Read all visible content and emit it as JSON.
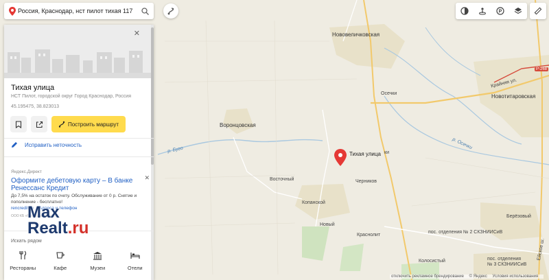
{
  "search": {
    "value": "Россия, Краснодар, нст пилот тихая 117"
  },
  "toolbar": {
    "icons": [
      "traffic-icon",
      "panorama-icon",
      "parking-icon",
      "layers-icon",
      "ruler-icon"
    ]
  },
  "map": {
    "labels": {
      "novovelichkovskaya": "Нововеличковская",
      "vorontsovskaya": "Воронцовская",
      "osechki": "Осечки",
      "novotitarovskaya": "Новотитаровская",
      "krainyaya": "Крайняя ул.",
      "vostochny": "Восточный",
      "chernikov": "Черников",
      "kopanskoy": "Копанской",
      "novy": "Новый",
      "krasnolit": "Краснолит",
      "berezovy": "Берёзовый",
      "pos2": "пос. отделения № 2 СКЗНИИСиВ",
      "pos3a": "пос. отделения",
      "pos3b": "№ 3 СКЗНИИСиВ",
      "kolosisty": "Колосистый",
      "eiskoe": "Ейское ш.",
      "ki": "ки"
    },
    "rivers": {
      "bulo": "р. Бугo",
      "osechki": "р. Осечки"
    },
    "road_badges": {
      "r268": "Р-268"
    },
    "pin_label": "Тихая улица"
  },
  "panel": {
    "title": "Тихая улица",
    "subtitle": "НСТ Пилот, городской округ Город Краснодар, Россия",
    "coords": "45.195475, 38.823013",
    "route_button": "Построить маршрут",
    "fix_label": "Исправить неточность",
    "ad": {
      "source": "Яндекс.Директ",
      "title": "Оформите дебетовую карту – В банке Ренессанс Кредит",
      "text": "До 7,5% на остаток по счету. Обслуживание от 0 р. Снятие и пополнение - бесплатно!",
      "link1": "rencredit.ru",
      "link2": "Адреса и телефон",
      "legal": "ООО КБ «Ренессанс Кредит»"
    },
    "search_nearby": "Искать рядом",
    "categories": [
      "Рестораны",
      "Кафе",
      "Музеи",
      "Отели"
    ]
  },
  "watermark": {
    "part1": "Max",
    "part2": "Realt",
    "part3": ".ru"
  },
  "footer": {
    "branding": "отключить рекламное брендирование",
    "yandex": "© Яндекс",
    "terms": "Условия использования"
  },
  "colors": {
    "accent_yellow": "#ffdb4d",
    "link_blue": "#2160c4",
    "pin_red": "#e53935"
  }
}
